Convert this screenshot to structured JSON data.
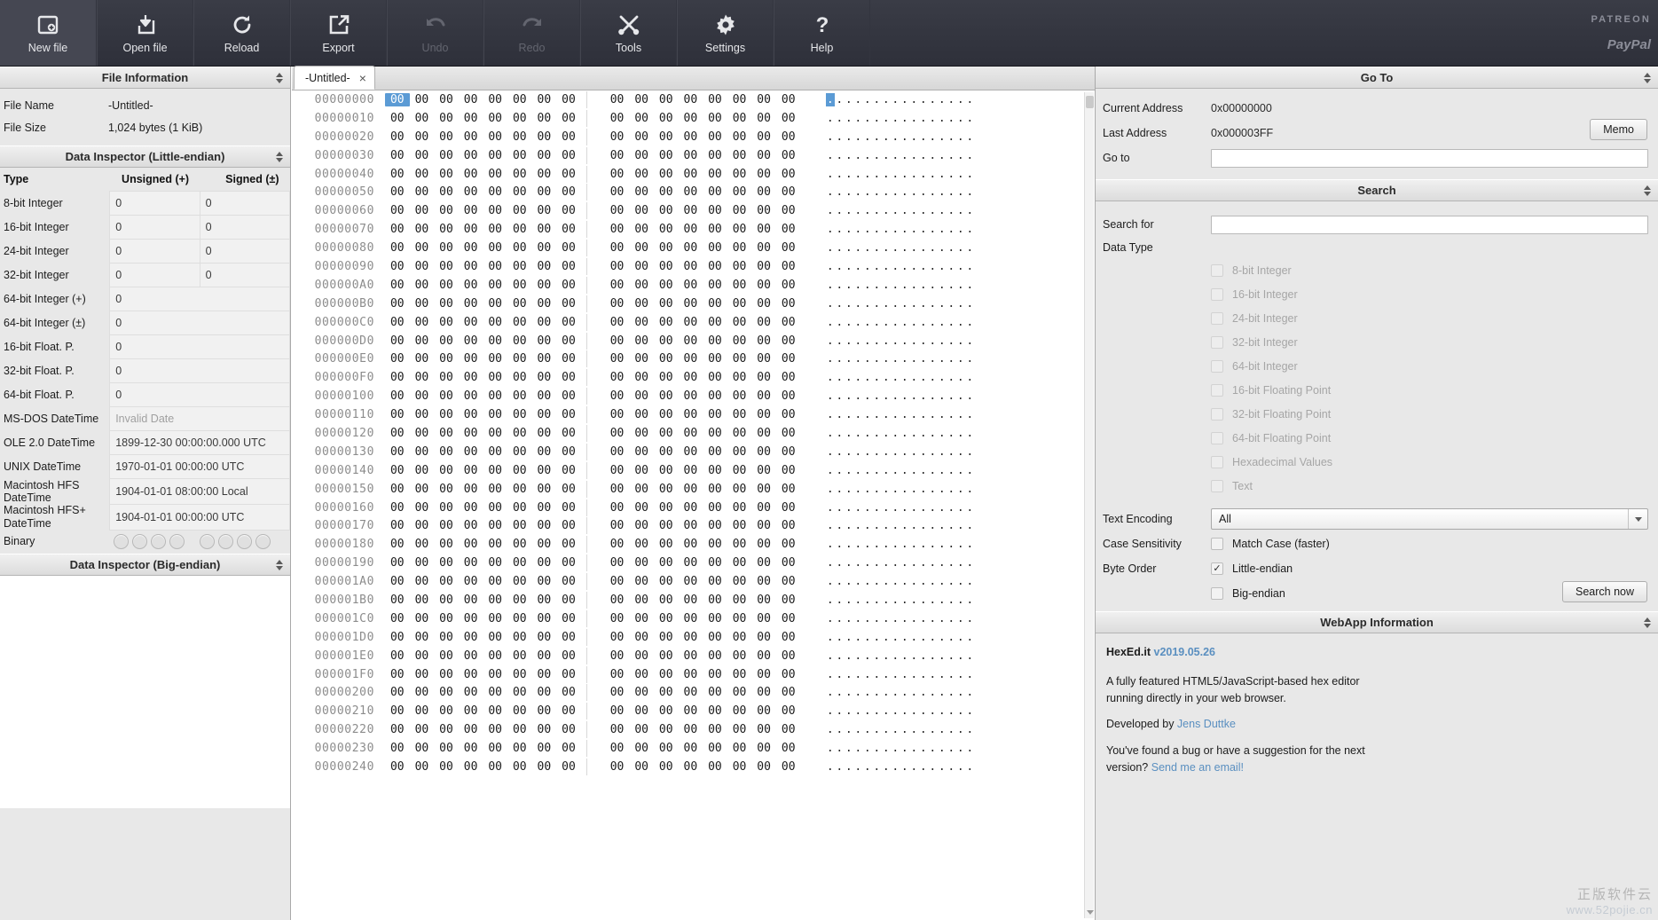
{
  "toolbar": {
    "buttons": [
      {
        "label": "New file",
        "icon": "new-file-icon",
        "disabled": false
      },
      {
        "label": "Open file",
        "icon": "open-file-icon",
        "disabled": false
      },
      {
        "label": "Reload",
        "icon": "reload-icon",
        "disabled": false
      },
      {
        "label": "Export",
        "icon": "export-icon",
        "disabled": false
      },
      {
        "label": "Undo",
        "icon": "undo-icon",
        "disabled": true
      },
      {
        "label": "Redo",
        "icon": "redo-icon",
        "disabled": true
      },
      {
        "label": "Tools",
        "icon": "tools-icon",
        "disabled": false
      },
      {
        "label": "Settings",
        "icon": "gear-icon",
        "disabled": false
      },
      {
        "label": "Help",
        "icon": "help-icon",
        "disabled": false
      }
    ],
    "patreon_label": "PATREON",
    "paypal_label": "PayPal"
  },
  "file_information": {
    "header": "File Information",
    "rows": [
      {
        "key": "File Name",
        "value": "-Untitled-"
      },
      {
        "key": "File Size",
        "value": "1,024 bytes (1 KiB)"
      }
    ]
  },
  "data_inspector_le": {
    "header": "Data Inspector (Little-endian)",
    "columns": [
      "Type",
      "Unsigned (+)",
      "Signed (±)"
    ],
    "rows": [
      {
        "type": "8-bit Integer",
        "unsigned": "0",
        "signed": "0",
        "two_cols": true
      },
      {
        "type": "16-bit Integer",
        "unsigned": "0",
        "signed": "0",
        "two_cols": true
      },
      {
        "type": "24-bit Integer",
        "unsigned": "0",
        "signed": "0",
        "two_cols": true
      },
      {
        "type": "32-bit Integer",
        "unsigned": "0",
        "signed": "0",
        "two_cols": true
      },
      {
        "type": "64-bit Integer (+)",
        "unsigned": "0",
        "signed": "",
        "two_cols": false
      },
      {
        "type": "64-bit Integer (±)",
        "unsigned": "0",
        "signed": "",
        "two_cols": false
      },
      {
        "type": "16-bit Float. P.",
        "unsigned": "0",
        "signed": "",
        "two_cols": false
      },
      {
        "type": "32-bit Float. P.",
        "unsigned": "0",
        "signed": "",
        "two_cols": false
      },
      {
        "type": "64-bit Float. P.",
        "unsigned": "0",
        "signed": "",
        "two_cols": false
      },
      {
        "type": "MS-DOS DateTime",
        "unsigned": "Invalid Date",
        "signed": "",
        "two_cols": false,
        "placeholder": true
      },
      {
        "type": "OLE 2.0 DateTime",
        "unsigned": "1899-12-30 00:00:00.000 UTC",
        "signed": "",
        "two_cols": false
      },
      {
        "type": "UNIX DateTime",
        "unsigned": "1970-01-01 00:00:00 UTC",
        "signed": "",
        "two_cols": false
      },
      {
        "type": "Macintosh HFS DateTime",
        "unsigned": "1904-01-01 08:00:00 Local",
        "signed": "",
        "two_cols": false
      },
      {
        "type": "Macintosh HFS+ DateTime",
        "unsigned": "1904-01-01 00:00:00 UTC",
        "signed": "",
        "two_cols": false
      }
    ],
    "binary_label": "Binary",
    "binary_bits": 8
  },
  "data_inspector_be": {
    "header": "Data Inspector (Big-endian)"
  },
  "editor": {
    "tab_label": "-Untitled-",
    "tab_close": "×",
    "bytes_per_row": 16,
    "byte_value": "00",
    "ascii_char": ".",
    "selected_index": 0,
    "addresses": [
      "00000000",
      "00000010",
      "00000020",
      "00000030",
      "00000040",
      "00000050",
      "00000060",
      "00000070",
      "00000080",
      "00000090",
      "000000A0",
      "000000B0",
      "000000C0",
      "000000D0",
      "000000E0",
      "000000F0",
      "00000100",
      "00000110",
      "00000120",
      "00000130",
      "00000140",
      "00000150",
      "00000160",
      "00000170",
      "00000180",
      "00000190",
      "000001A0",
      "000001B0",
      "000001C0",
      "000001D0",
      "000001E0",
      "000001F0",
      "00000200",
      "00000210",
      "00000220",
      "00000230",
      "00000240"
    ]
  },
  "goto": {
    "header": "Go To",
    "current_address_label": "Current Address",
    "current_address_value": "0x00000000",
    "last_address_label": "Last Address",
    "last_address_value": "0x000003FF",
    "goto_label": "Go to",
    "goto_value": "",
    "memo_button": "Memo"
  },
  "search": {
    "header": "Search",
    "search_for_label": "Search for",
    "search_for_value": "",
    "data_type_label": "Data Type",
    "data_types": [
      {
        "label": "8-bit Integer",
        "checked": false,
        "enabled": false
      },
      {
        "label": "16-bit Integer",
        "checked": false,
        "enabled": false
      },
      {
        "label": "24-bit Integer",
        "checked": false,
        "enabled": false
      },
      {
        "label": "32-bit Integer",
        "checked": false,
        "enabled": false
      },
      {
        "label": "64-bit Integer",
        "checked": false,
        "enabled": false
      },
      {
        "label": "16-bit Floating Point",
        "checked": false,
        "enabled": false
      },
      {
        "label": "32-bit Floating Point",
        "checked": false,
        "enabled": false
      },
      {
        "label": "64-bit Floating Point",
        "checked": false,
        "enabled": false
      },
      {
        "label": "Hexadecimal Values",
        "checked": false,
        "enabled": false
      },
      {
        "label": "Text",
        "checked": false,
        "enabled": false
      }
    ],
    "text_encoding_label": "Text Encoding",
    "text_encoding_value": "All",
    "case_sensitivity_label": "Case Sensitivity",
    "match_case_label": "Match Case (faster)",
    "match_case_checked": false,
    "byte_order_label": "Byte Order",
    "little_endian_label": "Little-endian",
    "little_endian_checked": true,
    "big_endian_label": "Big-endian",
    "big_endian_checked": false,
    "search_now_button": "Search now"
  },
  "webapp": {
    "header": "WebApp Information",
    "name": "HexEd.it",
    "version": "v2019.05.26",
    "description_1": "A fully featured HTML5/JavaScript-based hex editor",
    "description_2": "running directly in your web browser.",
    "developed_by_prefix": "Developed by ",
    "developer": "Jens Duttke",
    "bug_line_1": "You've found a bug or have a suggestion for the next",
    "bug_line_2_prefix": "version? ",
    "bug_link": "Send me an email!"
  },
  "watermark": {
    "cn": "正版软件云",
    "url": "www.52pojie.cn"
  },
  "colors": {
    "toolbar_bg": "#353742",
    "selection": "#5b9bd5",
    "panel_bg": "#e8e8e8",
    "link": "#5a8fc0"
  }
}
